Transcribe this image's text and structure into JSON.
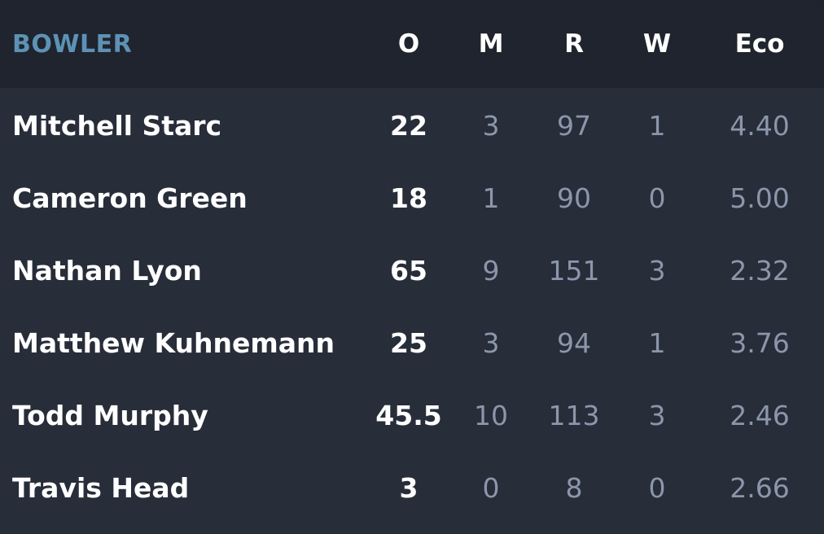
{
  "header": {
    "bowler": "BOWLER",
    "overs": "O",
    "maidens": "M",
    "runs": "R",
    "wickets": "W",
    "economy": "Eco"
  },
  "rows": [
    {
      "name": "Mitchell Starc",
      "o": "22",
      "m": "3",
      "r": "97",
      "w": "1",
      "eco": "4.40"
    },
    {
      "name": "Cameron Green",
      "o": "18",
      "m": "1",
      "r": "90",
      "w": "0",
      "eco": "5.00"
    },
    {
      "name": "Nathan Lyon",
      "o": "65",
      "m": "9",
      "r": "151",
      "w": "3",
      "eco": "2.32"
    },
    {
      "name": "Matthew Kuhnemann",
      "o": "25",
      "m": "3",
      "r": "94",
      "w": "1",
      "eco": "3.76"
    },
    {
      "name": "Todd Murphy",
      "o": "45.5",
      "m": "10",
      "r": "113",
      "w": "3",
      "eco": "2.46"
    },
    {
      "name": "Travis Head",
      "o": "3",
      "m": "0",
      "r": "8",
      "w": "0",
      "eco": "2.66"
    }
  ],
  "colors": {
    "background": "#272d39",
    "header_background": "#1f242e",
    "bowler_label": "#5d92b4",
    "primary_text": "#ffffff",
    "secondary_text": "#8c96ab"
  }
}
